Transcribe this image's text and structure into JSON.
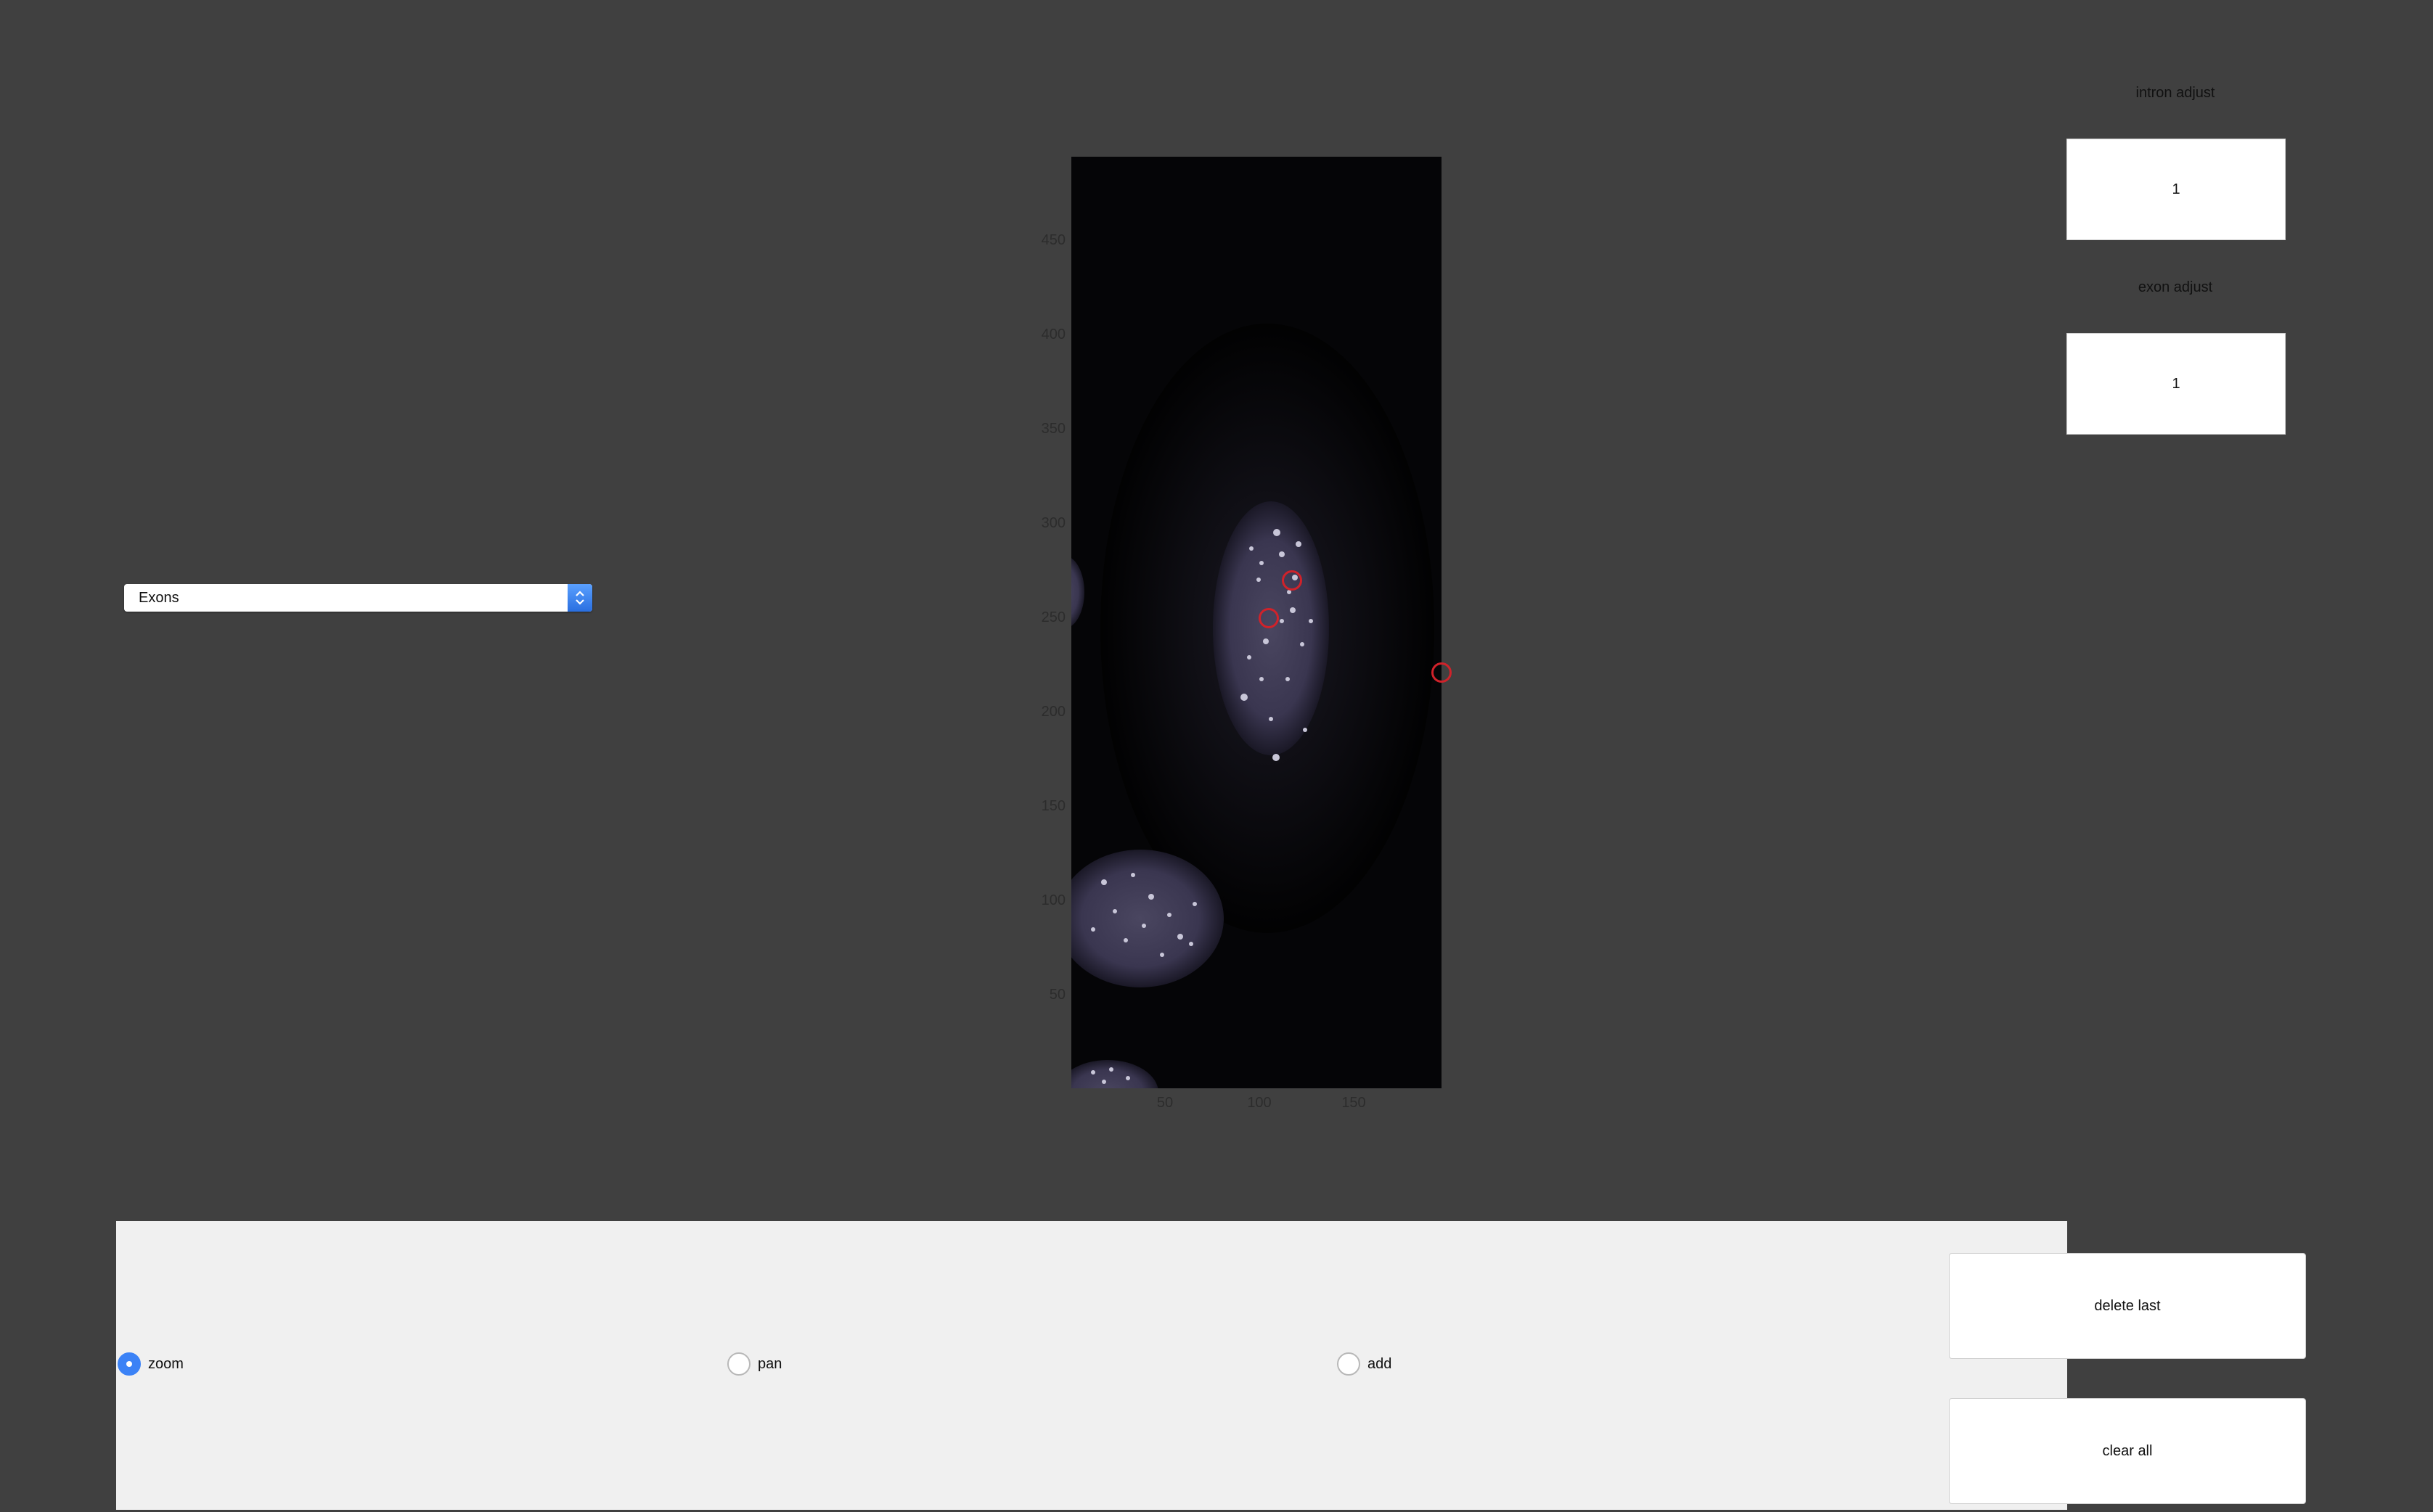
{
  "dropdown": {
    "selected": "Exons"
  },
  "axes": {
    "yticks": [
      "450",
      "400",
      "350",
      "300",
      "250",
      "200",
      "150",
      "100",
      "50"
    ],
    "xticks": [
      "50",
      "100",
      "150"
    ]
  },
  "intron": {
    "label": "intron adjust",
    "value": "1"
  },
  "exon": {
    "label": "exon adjust",
    "value": "1"
  },
  "mode": {
    "options": [
      {
        "label": "zoom",
        "selected": true
      },
      {
        "label": "pan",
        "selected": false
      },
      {
        "label": "add",
        "selected": false
      }
    ]
  },
  "buttons": {
    "delete_last": "delete last",
    "clear_all": "clear all"
  },
  "colors": {
    "background": "#404040",
    "panel": "#f0f0f0",
    "accent": "#3b82f6",
    "marker": "#d0222a"
  }
}
